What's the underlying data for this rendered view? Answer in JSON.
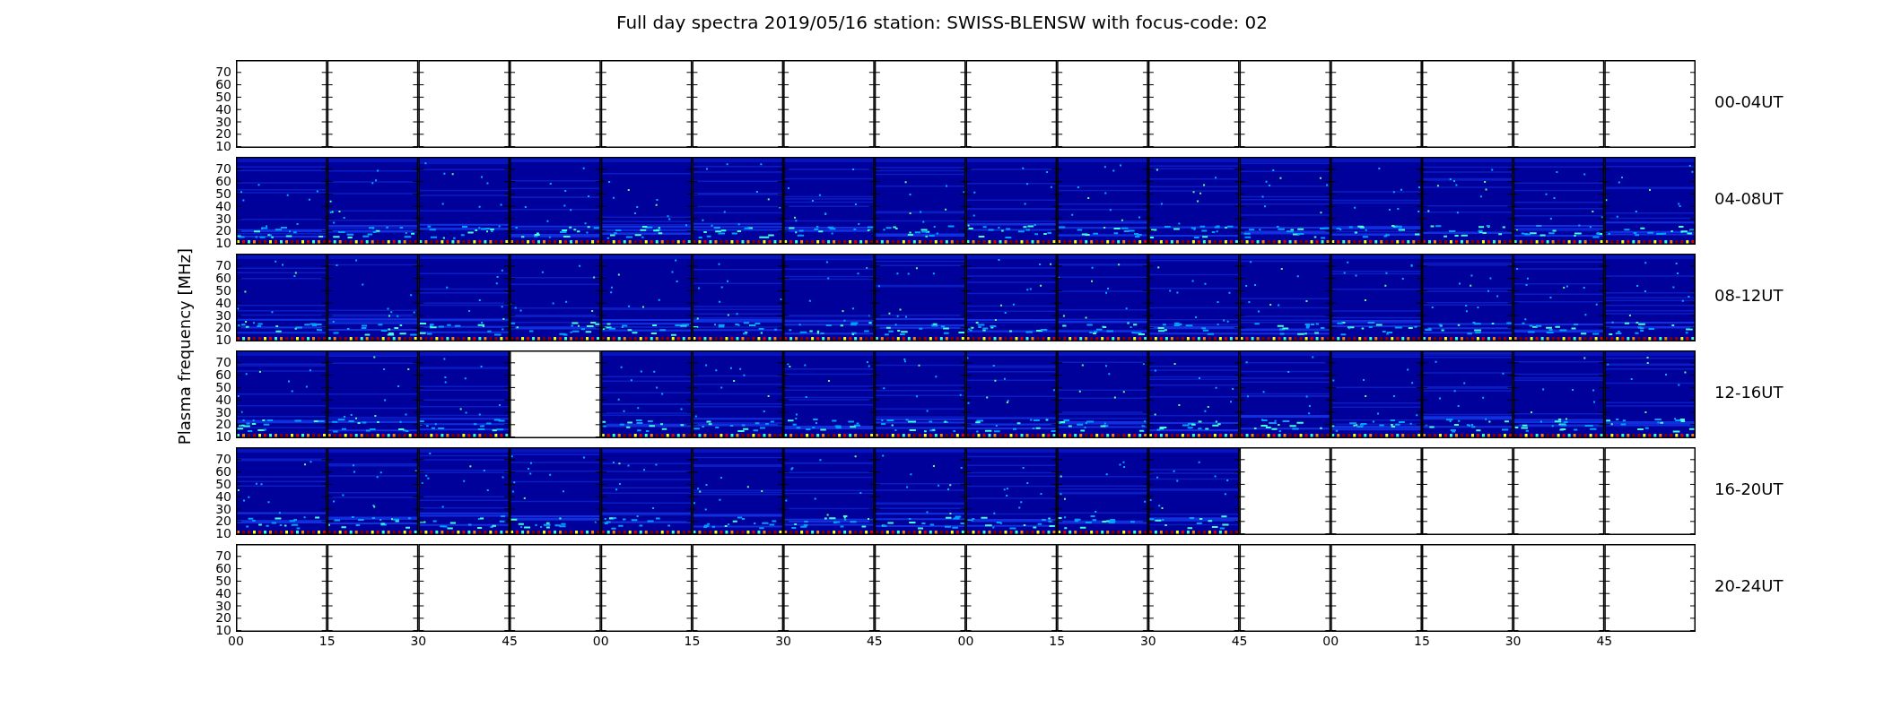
{
  "title": "Full day spectra 2019/05/16 station: SWISS-BLENSW with focus-code: 02",
  "ylabel": "Plasma frequency [MHz]",
  "x_ticks": [
    "00",
    "15",
    "30",
    "45",
    "00",
    "15",
    "30",
    "45",
    "00",
    "15",
    "30",
    "45",
    "00",
    "15",
    "30",
    "45"
  ],
  "rows": [
    {
      "label": "00-04UT",
      "y_ticks": [
        "70",
        "60",
        "50",
        "40",
        "30",
        "20",
        "10"
      ],
      "segments": [
        {
          "has_data": false
        },
        {
          "has_data": false
        },
        {
          "has_data": false
        },
        {
          "has_data": false
        },
        {
          "has_data": false
        },
        {
          "has_data": false
        },
        {
          "has_data": false
        },
        {
          "has_data": false
        },
        {
          "has_data": false
        },
        {
          "has_data": false
        },
        {
          "has_data": false
        },
        {
          "has_data": false
        },
        {
          "has_data": false
        },
        {
          "has_data": false
        },
        {
          "has_data": false
        },
        {
          "has_data": false
        }
      ]
    },
    {
      "label": "04-08UT",
      "y_ticks": [
        "70",
        "60",
        "50",
        "40",
        "30",
        "20",
        "10"
      ],
      "segments": [
        {
          "has_data": true
        },
        {
          "has_data": true
        },
        {
          "has_data": true
        },
        {
          "has_data": true
        },
        {
          "has_data": true
        },
        {
          "has_data": true
        },
        {
          "has_data": true
        },
        {
          "has_data": true
        },
        {
          "has_data": true
        },
        {
          "has_data": true
        },
        {
          "has_data": true
        },
        {
          "has_data": true
        },
        {
          "has_data": true
        },
        {
          "has_data": true
        },
        {
          "has_data": true
        },
        {
          "has_data": true
        }
      ]
    },
    {
      "label": "08-12UT",
      "y_ticks": [
        "70",
        "60",
        "50",
        "40",
        "30",
        "20",
        "10"
      ],
      "segments": [
        {
          "has_data": true
        },
        {
          "has_data": true
        },
        {
          "has_data": true
        },
        {
          "has_data": true
        },
        {
          "has_data": true
        },
        {
          "has_data": true
        },
        {
          "has_data": true
        },
        {
          "has_data": true
        },
        {
          "has_data": true
        },
        {
          "has_data": true
        },
        {
          "has_data": true
        },
        {
          "has_data": true
        },
        {
          "has_data": true
        },
        {
          "has_data": true
        },
        {
          "has_data": true
        },
        {
          "has_data": true
        }
      ]
    },
    {
      "label": "12-16UT",
      "y_ticks": [
        "70",
        "60",
        "50",
        "40",
        "30",
        "20",
        "10"
      ],
      "segments": [
        {
          "has_data": true
        },
        {
          "has_data": true
        },
        {
          "has_data": true
        },
        {
          "has_data": false
        },
        {
          "has_data": true
        },
        {
          "has_data": true
        },
        {
          "has_data": true
        },
        {
          "has_data": true
        },
        {
          "has_data": true
        },
        {
          "has_data": true
        },
        {
          "has_data": true
        },
        {
          "has_data": true
        },
        {
          "has_data": true
        },
        {
          "has_data": true
        },
        {
          "has_data": true
        },
        {
          "has_data": true
        }
      ]
    },
    {
      "label": "16-20UT",
      "y_ticks": [
        "70",
        "60",
        "50",
        "40",
        "30",
        "20",
        "10"
      ],
      "segments": [
        {
          "has_data": true
        },
        {
          "has_data": true
        },
        {
          "has_data": true
        },
        {
          "has_data": true
        },
        {
          "has_data": true
        },
        {
          "has_data": true
        },
        {
          "has_data": true
        },
        {
          "has_data": true
        },
        {
          "has_data": true
        },
        {
          "has_data": true
        },
        {
          "has_data": true
        },
        {
          "has_data": false
        },
        {
          "has_data": false
        },
        {
          "has_data": false
        },
        {
          "has_data": false
        },
        {
          "has_data": false
        }
      ]
    },
    {
      "label": "20-24UT",
      "y_ticks": [
        "70",
        "60",
        "50",
        "40",
        "30",
        "20",
        "10"
      ],
      "segments": [
        {
          "has_data": false
        },
        {
          "has_data": false
        },
        {
          "has_data": false
        },
        {
          "has_data": false
        },
        {
          "has_data": false
        },
        {
          "has_data": false
        },
        {
          "has_data": false
        },
        {
          "has_data": false
        },
        {
          "has_data": false
        },
        {
          "has_data": false
        },
        {
          "has_data": false
        },
        {
          "has_data": false
        },
        {
          "has_data": false
        },
        {
          "has_data": false
        },
        {
          "has_data": false
        },
        {
          "has_data": false
        }
      ]
    }
  ]
}
